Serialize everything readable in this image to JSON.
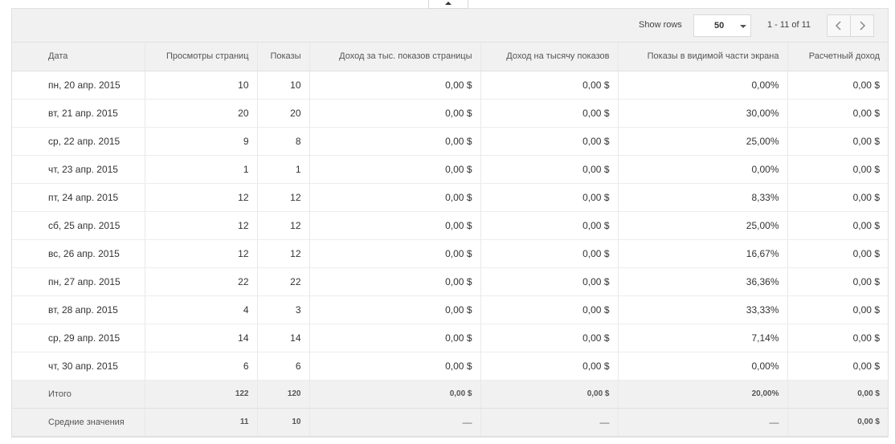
{
  "toolbar": {
    "show_rows_label": "Show rows",
    "rows_value": "50",
    "range_text": "1 - 11 of 11"
  },
  "columns": [
    "Дата",
    "Просмотры страниц",
    "Показы",
    "Доход за тыс. показов страницы",
    "Доход на тысячу показов",
    "Показы в видимой части экрана",
    "Расчетный доход"
  ],
  "rows": [
    [
      "пн, 20 апр. 2015",
      "10",
      "10",
      "0,00 $",
      "0,00 $",
      "0,00%",
      "0,00 $"
    ],
    [
      "вт, 21 апр. 2015",
      "20",
      "20",
      "0,00 $",
      "0,00 $",
      "30,00%",
      "0,00 $"
    ],
    [
      "ср, 22 апр. 2015",
      "9",
      "8",
      "0,00 $",
      "0,00 $",
      "25,00%",
      "0,00 $"
    ],
    [
      "чт, 23 апр. 2015",
      "1",
      "1",
      "0,00 $",
      "0,00 $",
      "0,00%",
      "0,00 $"
    ],
    [
      "пт, 24 апр. 2015",
      "12",
      "12",
      "0,00 $",
      "0,00 $",
      "8,33%",
      "0,00 $"
    ],
    [
      "сб, 25 апр. 2015",
      "12",
      "12",
      "0,00 $",
      "0,00 $",
      "25,00%",
      "0,00 $"
    ],
    [
      "вс, 26 апр. 2015",
      "12",
      "12",
      "0,00 $",
      "0,00 $",
      "16,67%",
      "0,00 $"
    ],
    [
      "пн, 27 апр. 2015",
      "22",
      "22",
      "0,00 $",
      "0,00 $",
      "36,36%",
      "0,00 $"
    ],
    [
      "вт, 28 апр. 2015",
      "4",
      "3",
      "0,00 $",
      "0,00 $",
      "33,33%",
      "0,00 $"
    ],
    [
      "ср, 29 апр. 2015",
      "14",
      "14",
      "0,00 $",
      "0,00 $",
      "7,14%",
      "0,00 $"
    ],
    [
      "чт, 30 апр. 2015",
      "6",
      "6",
      "0,00 $",
      "0,00 $",
      "0,00%",
      "0,00 $"
    ]
  ],
  "totals": {
    "label": "Итого",
    "values": [
      "122",
      "120",
      "0,00 $",
      "0,00 $",
      "20,00%",
      "0,00 $"
    ]
  },
  "averages": {
    "label": "Средние значения",
    "values": [
      "11",
      "10",
      "—",
      "—",
      "—",
      "0,00 $"
    ]
  },
  "icons": {
    "collapse": "caret-up-icon",
    "dropdown": "triangle-down-icon",
    "prev": "chevron-left-icon",
    "next": "chevron-right-icon"
  },
  "colors": {
    "header_bg": "#f1f1f1",
    "border": "#e0e0e0",
    "text": "#333333"
  }
}
